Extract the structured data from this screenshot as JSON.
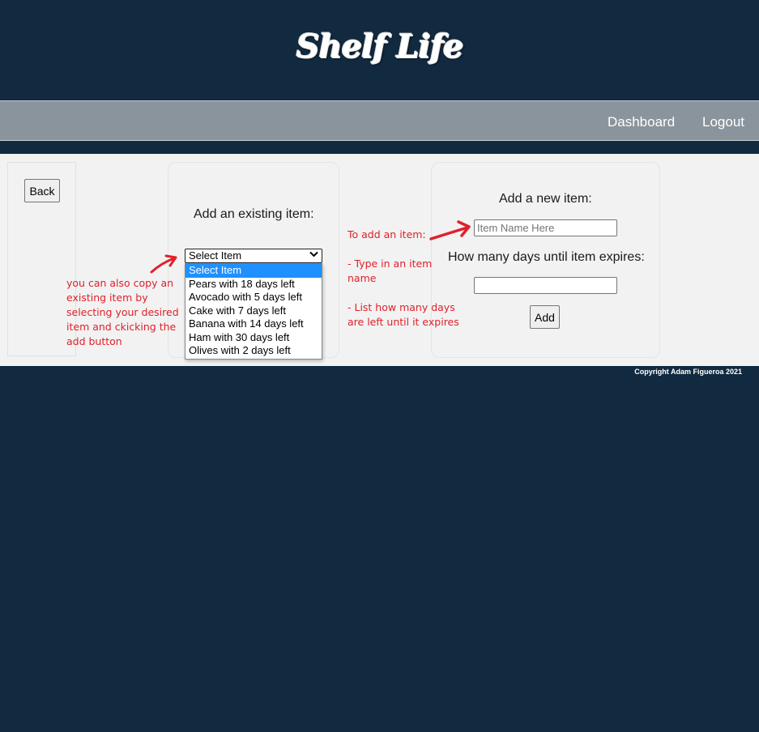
{
  "header": {
    "logo_text": "Shelf Life"
  },
  "nav": {
    "dashboard_label": "Dashboard",
    "logout_label": "Logout"
  },
  "back_button_label": "Back",
  "existing_item": {
    "heading": "Add an existing item:",
    "selected_value": "Select Item",
    "options": [
      "Select Item",
      "Pears with 18 days left",
      "Avocado with 5 days left",
      "Cake with 7 days left",
      "Banana with 14 days left",
      "Ham with 30 days left",
      "Olives with 2 days left"
    ]
  },
  "new_item": {
    "heading": "Add a new item:",
    "name_placeholder": "Item Name Here",
    "name_value": "",
    "days_label": "How many days until item expires:",
    "days_value": "",
    "add_label": "Add"
  },
  "annotations": {
    "copy_note": [
      "you can also copy an",
      "existing item by",
      "selecting your desired",
      "item and ckicking the",
      "add button"
    ],
    "add_note": [
      "To add an item:",
      "",
      "- Type in an item",
      "name",
      "",
      "- List how many days",
      "are left until it expires"
    ]
  },
  "footer": {
    "copyright": "Copyright Adam Figueroa 2021"
  },
  "colors": {
    "page_background": "#122a40",
    "nav_background": "#8a949c",
    "content_background": "#f2f2f2",
    "annotation_red": "#e0202a",
    "option_highlight": "#1e90ff"
  }
}
